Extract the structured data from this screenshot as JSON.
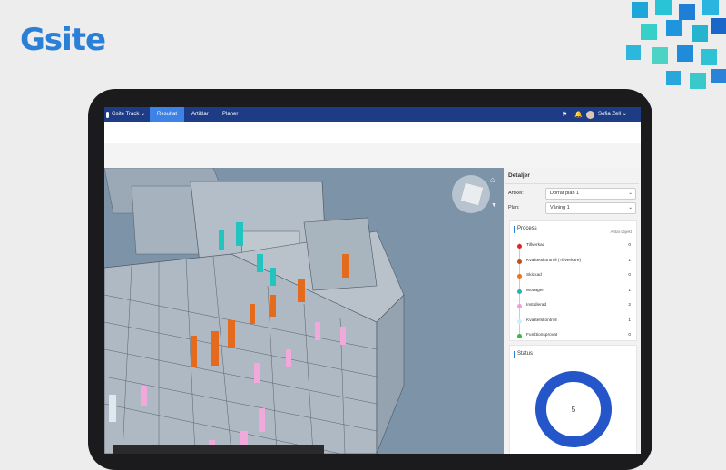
{
  "brand": {
    "logo_text": "Gsite"
  },
  "nav": {
    "app_menu": "Gsite Track",
    "tabs": [
      {
        "label": "Resultat",
        "active": true
      },
      {
        "label": "Artiklar",
        "active": false
      },
      {
        "label": "Planer",
        "active": false
      }
    ],
    "user_name": "Sofia Zell"
  },
  "details": {
    "title": "Detaljer",
    "article_label": "Artikel:",
    "article_value": "Dörrar plan 1",
    "plan_label": "Plan:",
    "plan_value": "Våning 1"
  },
  "process": {
    "title": "Process",
    "count_header": "Antal objekt",
    "items": [
      {
        "label": "Tillverkad",
        "count": "0",
        "color": "#d9262a"
      },
      {
        "label": "Kvalitetskontroll (Tillverkare)",
        "count": "1",
        "color": "#b8531a"
      },
      {
        "label": "Skickad",
        "count": "0",
        "color": "#e8731e"
      },
      {
        "label": "Mottagen",
        "count": "1",
        "color": "#1fb5b0"
      },
      {
        "label": "Installerad",
        "count": "2",
        "color": "#f29bd9"
      },
      {
        "label": "Kvalitetskontroll",
        "count": "1",
        "color": "#cfeefb"
      },
      {
        "label": "Funktionsprovat",
        "count": "0",
        "color": "#39b54a"
      }
    ]
  },
  "status": {
    "title": "Status",
    "total": "5",
    "ring_color": "#2456c9"
  },
  "icons": [
    "home-icon",
    "view-cube-icon",
    "filter-icon",
    "bell-icon",
    "chevron-down-icon",
    "user-avatar-icon"
  ],
  "colors": {
    "topbar": "#1e3c86",
    "active_tab": "#3d82e6",
    "brand": "#2a7fd6",
    "viewer_bg": "#7d93a8"
  }
}
